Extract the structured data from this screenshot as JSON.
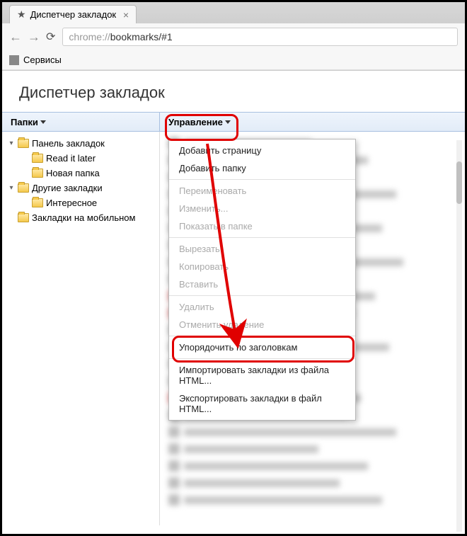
{
  "browser": {
    "tab_title": "Диспетчер закладок",
    "url_prefix": "chrome://",
    "url_path": "bookmarks/#1",
    "services_label": "Сервисы"
  },
  "page": {
    "title": "Диспетчер закладок",
    "folders_header": "Папки",
    "manage_header": "Управление"
  },
  "tree": [
    {
      "label": "Панель закладок",
      "depth": 0,
      "expandable": true,
      "open": true
    },
    {
      "label": "Read it later",
      "depth": 1,
      "expandable": false,
      "open": false
    },
    {
      "label": "Новая папка",
      "depth": 1,
      "expandable": false,
      "open": false
    },
    {
      "label": "Другие закладки",
      "depth": 0,
      "expandable": true,
      "open": true
    },
    {
      "label": "Интересное",
      "depth": 1,
      "expandable": false,
      "open": false
    },
    {
      "label": "Закладки на мобильном",
      "depth": 0,
      "expandable": false,
      "open": false
    }
  ],
  "menu": {
    "items": [
      {
        "label": "Добавить страницу",
        "enabled": true
      },
      {
        "label": "Добавить папку",
        "enabled": true
      },
      {
        "sep": true
      },
      {
        "label": "Переименовать",
        "enabled": false
      },
      {
        "label": "Изменить...",
        "enabled": false
      },
      {
        "label": "Показать в папке",
        "enabled": false
      },
      {
        "sep": true
      },
      {
        "label": "Вырезать",
        "enabled": false
      },
      {
        "label": "Копировать",
        "enabled": false
      },
      {
        "label": "Вставить",
        "enabled": false
      },
      {
        "sep": true
      },
      {
        "label": "Удалить",
        "enabled": false
      },
      {
        "label": "Отменить удаление",
        "enabled": false
      },
      {
        "sep": true
      },
      {
        "label": "Упорядочить по заголовкам",
        "enabled": true
      },
      {
        "sep": true
      },
      {
        "label": "Импортировать закладки из файла HTML...",
        "enabled": true
      },
      {
        "label": "Экспортировать закладки в файл HTML...",
        "enabled": true
      }
    ]
  },
  "annotation": {
    "highlight_color": "#e00000"
  }
}
